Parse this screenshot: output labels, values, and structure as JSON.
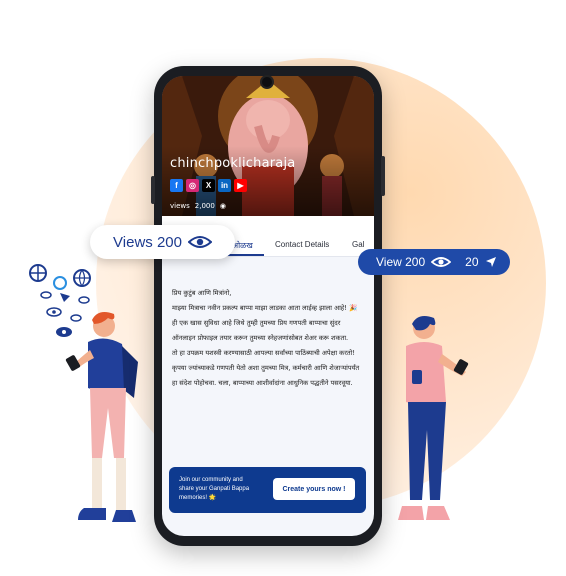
{
  "profile": {
    "name": "chinchpoklicharaja",
    "views_label": "views",
    "views_count": "2,000"
  },
  "socials": [
    "facebook",
    "instagram",
    "x",
    "linkedin",
    "youtube"
  ],
  "tabs": [
    {
      "label": "ओळख"
    },
    {
      "label": "Contact Details"
    },
    {
      "label": "Gal"
    }
  ],
  "content": {
    "paragraphs": [
      "प्रिय कुटुंब आणि मित्रांनो,",
      "माझ्या मित्राचा नवीन प्रकल्प बाप्पा माझा लाडका आता लाईव्ह झाला आहे! 🎉 ही एक खास सुविधा आहे जिथे तुम्ही तुमच्या प्रिय गणपती बाप्पाचा सुंदर ऑनलाइन प्रोफाइल तयार करून तुमच्या स्नेहजणांसोबत शेअर करू शकता.",
      "तो हा उपक्रम यशस्वी करण्यासाठी आपल्या सर्वांच्या पाठिंब्याची अपेक्षा करतो! कृपया ज्यांच्याकडे गणपती येतो अशा तुमच्या मित्र, कर्मचारी आणि शेजाऱ्यांपर्यंत हा संदेश पोहोचवा. चला, बाप्पाच्या आशीर्वादांना आधुनिक पद्धतीने पसरवूया."
    ]
  },
  "cta": {
    "text": "Join our community and share your Ganpati Bappa memories! 🌟",
    "button": "Create yours now !"
  },
  "overlay_views": {
    "label": "Views 200"
  },
  "overlay_stats": {
    "views": "View 200",
    "shares": "20"
  },
  "colors": {
    "brand": "#1d3b8f",
    "accent": "#1f4aa8",
    "background_glow": "#ffd9b0"
  }
}
